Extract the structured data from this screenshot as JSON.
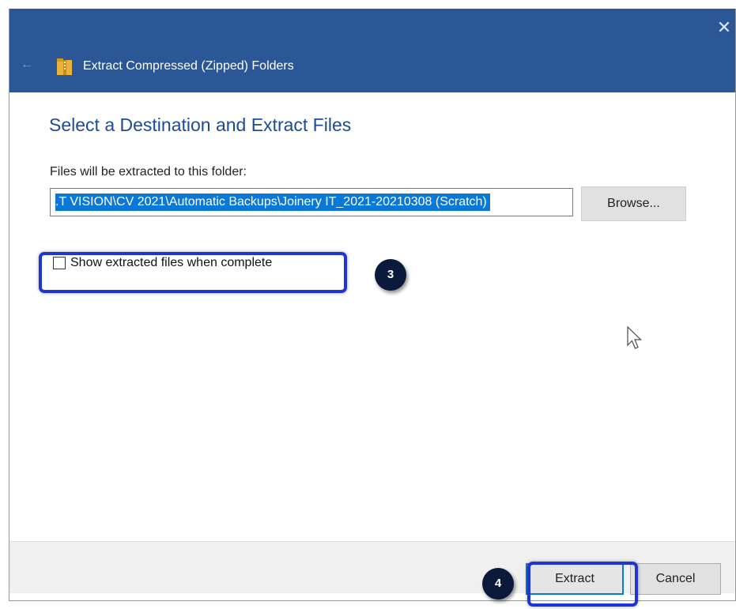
{
  "window": {
    "title": "Extract Compressed (Zipped) Folders",
    "close_glyph": "✕",
    "back_glyph": "←",
    "titlebar_color": "#2b5797"
  },
  "content": {
    "heading": "Select a Destination and Extract Files",
    "destination_label": "Files will be extracted to this folder:",
    "destination_value": ".T VISION\\CV 2021\\Automatic Backups\\Joinery IT_2021-20210308 (Scratch)",
    "browse_label": "Browse...",
    "show_files_label": "Show extracted files when complete",
    "show_files_checked": false
  },
  "footer": {
    "extract_label": "Extract",
    "cancel_label": "Cancel"
  },
  "annotations": {
    "step_3": "3",
    "step_4": "4",
    "highlight_color": "#1f35d4"
  },
  "icons": {
    "folder_icon": "zipped-folder-icon",
    "close_icon": "close-icon",
    "back_icon": "back-arrow-icon",
    "cursor_icon": "mouse-pointer-icon"
  }
}
